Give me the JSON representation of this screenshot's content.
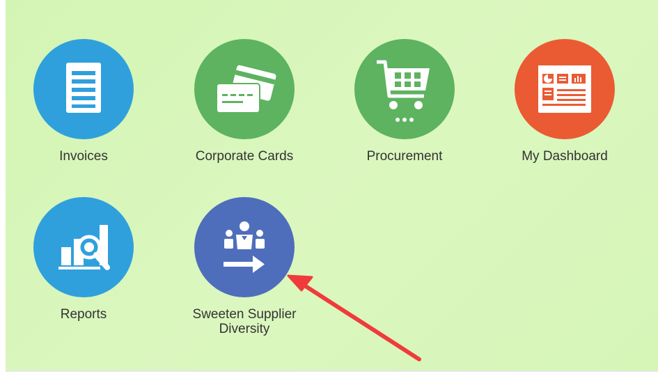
{
  "apps": [
    {
      "label": "Invoices",
      "color": "#30a0dd",
      "icon": "invoice-icon"
    },
    {
      "label": "Corporate Cards",
      "color": "#5db35f",
      "icon": "credit-cards-icon"
    },
    {
      "label": "Procurement",
      "color": "#5db35f",
      "icon": "shopping-cart-icon"
    },
    {
      "label": "My Dashboard",
      "color": "#ea5b33",
      "icon": "dashboard-icon"
    },
    {
      "label": "Reports",
      "color": "#30a0dd",
      "icon": "reports-icon"
    },
    {
      "label": "Sweeten Supplier Diversity",
      "color": "#4e6ebc",
      "icon": "supplier-diversity-icon"
    }
  ],
  "annotation": {
    "color": "#ef3b3b",
    "icon": "red-arrow-annotation"
  }
}
